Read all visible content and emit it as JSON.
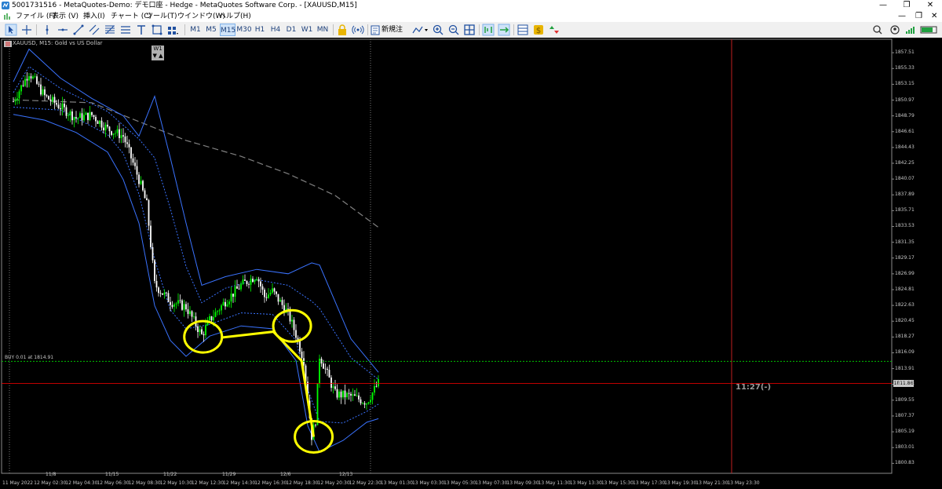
{
  "window": {
    "title": "5001731516 - MetaQuotes-Demo: デモ口座 - Hedge - MetaQuotes Software Corp. - [XAUUSD,M15]",
    "controls": {
      "minimize": "—",
      "restore": "❐",
      "close": "✕"
    }
  },
  "menu": [
    "ファイル (F)",
    "表示 (V)",
    "挿入(I)",
    "チャート (C)",
    "ツール(T)",
    "ウインドウ(W)",
    "ヘルプ(H)"
  ],
  "toolbar": {
    "timeframes": [
      "M1",
      "M5",
      "M15",
      "M30",
      "H1",
      "H4",
      "D1",
      "W1",
      "MN"
    ],
    "selected_timeframe": "M15",
    "new_order_label": "新規注文"
  },
  "chart": {
    "symbol_label": "XAUUSD, M15:  Gold vs US Dollar",
    "period_badge": "W1",
    "period_badge_arrows": "▼ ▲",
    "trade_label": "BUY 0.01 at 1814.91",
    "timer": "11:27(-)",
    "current_price": "1811.86",
    "price_scale": [
      "1857.51",
      "1855.33",
      "1853.15",
      "1850.97",
      "1848.79",
      "1846.61",
      "1844.43",
      "1842.25",
      "1840.07",
      "1837.89",
      "1835.71",
      "1833.53",
      "1831.35",
      "1829.17",
      "1826.99",
      "1824.81",
      "1822.63",
      "1820.45",
      "1818.27",
      "1816.09",
      "1813.91",
      "1811.73",
      "1809.55",
      "1807.37",
      "1805.19",
      "1803.01",
      "1800.83"
    ],
    "time_scale": [
      "11 May 2022",
      "12 May 02:30",
      "12 May 04:30",
      "12 May 06:30",
      "12 May 08:30",
      "12 May 10:30",
      "12 May 12:30",
      "12 May 14:30",
      "12 May 16:30",
      "12 May 18:30",
      "12 May 20:30",
      "12 May 22:30",
      "13 May 01:30",
      "13 May 03:30",
      "13 May 05:30",
      "13 May 07:30",
      "13 May 09:30",
      "13 May 11:30",
      "13 May 13:30",
      "13 May 15:30",
      "13 May 17:30",
      "13 May 19:30",
      "13 May 21:30",
      "13 May 23:30"
    ],
    "week_separators": [
      "11/8",
      "11/15",
      "11/22",
      "11/29",
      "12/6",
      "12/13"
    ],
    "colors": {
      "background": "#000000",
      "bull_candle": "#00ff00",
      "bear_candle": "#ffffff",
      "bollinger_outer": "#3a73ff",
      "bollinger_inner": "#3a73ff",
      "long_ma": "#808080",
      "annotation": "#ffff00",
      "bid_line": "#ff0000",
      "trade_line": "#00c000"
    },
    "annotation_circles": [
      {
        "time": "13 May 00:40",
        "price": 1818.3
      },
      {
        "time": "13 May 12:00",
        "price": 1819.8
      },
      {
        "time": "13 May 14:45",
        "price": 1804.5
      }
    ],
    "annotation_path_prices": [
      1818.2,
      1819.0,
      1815.0,
      1804.5
    ]
  },
  "chart_data": {
    "type": "candlestick",
    "symbol": "XAUUSD",
    "timeframe": "M15",
    "ylim": [
      1800.0,
      1858.5
    ],
    "current_price": 1811.86,
    "bid_line_price": 1811.86,
    "trade_price": 1814.91,
    "close_path": [
      {
        "t": "12 May 00:30",
        "price": 1850.8
      },
      {
        "t": "12 May 02:30",
        "price": 1854.8
      },
      {
        "t": "12 May 04:30",
        "price": 1851.5
      },
      {
        "t": "12 May 06:00",
        "price": 1850.4
      },
      {
        "t": "12 May 08:30",
        "price": 1848.5
      },
      {
        "t": "12 May 10:30",
        "price": 1848.9
      },
      {
        "t": "12 May 12:30",
        "price": 1847.0
      },
      {
        "t": "12 May 14:30",
        "price": 1846.0
      },
      {
        "t": "12 May 16:30",
        "price": 1840.0
      },
      {
        "t": "12 May 17:30",
        "price": 1836.5
      },
      {
        "t": "12 May 18:30",
        "price": 1825.5
      },
      {
        "t": "12 May 20:30",
        "price": 1823.2
      },
      {
        "t": "12 May 22:30",
        "price": 1822.4
      },
      {
        "t": "13 May 00:30",
        "price": 1818.5
      },
      {
        "t": "13 May 01:30",
        "price": 1820.6
      },
      {
        "t": "13 May 03:30",
        "price": 1823.2
      },
      {
        "t": "13 May 05:30",
        "price": 1825.4
      },
      {
        "t": "13 May 07:30",
        "price": 1826.8
      },
      {
        "t": "13 May 08:30",
        "price": 1823.8
      },
      {
        "t": "13 May 09:30",
        "price": 1824.6
      },
      {
        "t": "13 May 11:30",
        "price": 1821.5
      },
      {
        "t": "13 May 12:30",
        "price": 1818.6
      },
      {
        "t": "13 May 13:30",
        "price": 1815.0
      },
      {
        "t": "13 May 14:30",
        "price": 1804.5
      },
      {
        "t": "13 May 15:00",
        "price": 1806.8
      },
      {
        "t": "13 May 15:30",
        "price": 1815.8
      },
      {
        "t": "13 May 17:30",
        "price": 1810.4
      },
      {
        "t": "13 May 19:30",
        "price": 1810.1
      },
      {
        "t": "13 May 21:30",
        "price": 1809.3
      },
      {
        "t": "13 May 23:00",
        "price": 1811.9
      }
    ],
    "bollinger_outer_upper": [
      {
        "t": "12 May 00:30",
        "price": 1853.5
      },
      {
        "t": "12 May 02:30",
        "price": 1858.0
      },
      {
        "t": "12 May 06:30",
        "price": 1854.0
      },
      {
        "t": "12 May 10:30",
        "price": 1851.2
      },
      {
        "t": "12 May 14:30",
        "price": 1848.8
      },
      {
        "t": "12 May 16:30",
        "price": 1846.0
      },
      {
        "t": "12 May 18:30",
        "price": 1851.5
      },
      {
        "t": "12 May 20:30",
        "price": 1843.0
      },
      {
        "t": "12 May 22:30",
        "price": 1834.0
      },
      {
        "t": "13 May 00:30",
        "price": 1825.4
      },
      {
        "t": "13 May 03:30",
        "price": 1826.6
      },
      {
        "t": "13 May 07:30",
        "price": 1827.6
      },
      {
        "t": "13 May 11:30",
        "price": 1827.0
      },
      {
        "t": "13 May 14:30",
        "price": 1828.5
      },
      {
        "t": "13 May 15:30",
        "price": 1828.2
      },
      {
        "t": "13 May 19:30",
        "price": 1818.0
      },
      {
        "t": "13 May 23:00",
        "price": 1813.4
      }
    ],
    "bollinger_outer_lower": [
      {
        "t": "12 May 00:30",
        "price": 1849.0
      },
      {
        "t": "12 May 04:30",
        "price": 1848.2
      },
      {
        "t": "12 May 08:30",
        "price": 1846.5
      },
      {
        "t": "12 May 12:30",
        "price": 1843.8
      },
      {
        "t": "12 May 14:30",
        "price": 1840.0
      },
      {
        "t": "12 May 16:30",
        "price": 1834.0
      },
      {
        "t": "12 May 18:30",
        "price": 1822.6
      },
      {
        "t": "12 May 20:30",
        "price": 1817.8
      },
      {
        "t": "12 May 22:30",
        "price": 1815.6
      },
      {
        "t": "13 May 01:30",
        "price": 1818.4
      },
      {
        "t": "13 May 05:30",
        "price": 1819.8
      },
      {
        "t": "13 May 09:30",
        "price": 1819.4
      },
      {
        "t": "13 May 12:30",
        "price": 1815.0
      },
      {
        "t": "13 May 14:00",
        "price": 1806.0
      },
      {
        "t": "13 May 15:30",
        "price": 1802.4
      },
      {
        "t": "13 May 18:30",
        "price": 1804.0
      },
      {
        "t": "13 May 21:30",
        "price": 1806.5
      },
      {
        "t": "13 May 23:00",
        "price": 1807.0
      }
    ],
    "bollinger_inner_upper": [
      {
        "t": "12 May 00:30",
        "price": 1852.0
      },
      {
        "t": "12 May 02:30",
        "price": 1855.6
      },
      {
        "t": "12 May 06:30",
        "price": 1852.6
      },
      {
        "t": "12 May 12:30",
        "price": 1849.4
      },
      {
        "t": "12 May 16:30",
        "price": 1845.6
      },
      {
        "t": "12 May 18:30",
        "price": 1843.0
      },
      {
        "t": "12 May 20:30",
        "price": 1836.0
      },
      {
        "t": "12 May 22:30",
        "price": 1828.0
      },
      {
        "t": "13 May 00:30",
        "price": 1823.0
      },
      {
        "t": "13 May 03:30",
        "price": 1825.0
      },
      {
        "t": "13 May 07:30",
        "price": 1826.2
      },
      {
        "t": "13 May 11:30",
        "price": 1825.4
      },
      {
        "t": "13 May 14:30",
        "price": 1823.2
      },
      {
        "t": "13 May 15:30",
        "price": 1822.2
      },
      {
        "t": "13 May 19:30",
        "price": 1815.4
      },
      {
        "t": "13 May 23:00",
        "price": 1812.4
      }
    ],
    "bollinger_inner_lower": [
      {
        "t": "12 May 00:30",
        "price": 1850.0
      },
      {
        "t": "12 May 06:30",
        "price": 1849.6
      },
      {
        "t": "12 May 12:30",
        "price": 1846.2
      },
      {
        "t": "12 May 14:30",
        "price": 1843.6
      },
      {
        "t": "12 May 16:30",
        "price": 1838.0
      },
      {
        "t": "12 May 18:30",
        "price": 1829.0
      },
      {
        "t": "12 May 20:30",
        "price": 1822.0
      },
      {
        "t": "12 May 22:30",
        "price": 1819.4
      },
      {
        "t": "13 May 01:30",
        "price": 1820.0
      },
      {
        "t": "13 May 05:30",
        "price": 1821.6
      },
      {
        "t": "13 May 09:30",
        "price": 1821.4
      },
      {
        "t": "13 May 12:30",
        "price": 1817.8
      },
      {
        "t": "13 May 14:00",
        "price": 1811.0
      },
      {
        "t": "13 May 15:30",
        "price": 1806.6
      },
      {
        "t": "13 May 18:30",
        "price": 1806.4
      },
      {
        "t": "13 May 21:30",
        "price": 1808.0
      },
      {
        "t": "13 May 23:00",
        "price": 1809.0
      }
    ],
    "long_ma": [
      {
        "t": "12 May 00:30",
        "price": 1851.0
      },
      {
        "t": "12 May 10:30",
        "price": 1850.6
      },
      {
        "t": "12 May 16:30",
        "price": 1848.0
      },
      {
        "t": "12 May 22:30",
        "price": 1845.4
      },
      {
        "t": "13 May 05:30",
        "price": 1843.2
      },
      {
        "t": "13 May 11:30",
        "price": 1840.8
      },
      {
        "t": "13 May 17:30",
        "price": 1837.8
      },
      {
        "t": "13 May 23:00",
        "price": 1833.4
      }
    ]
  }
}
